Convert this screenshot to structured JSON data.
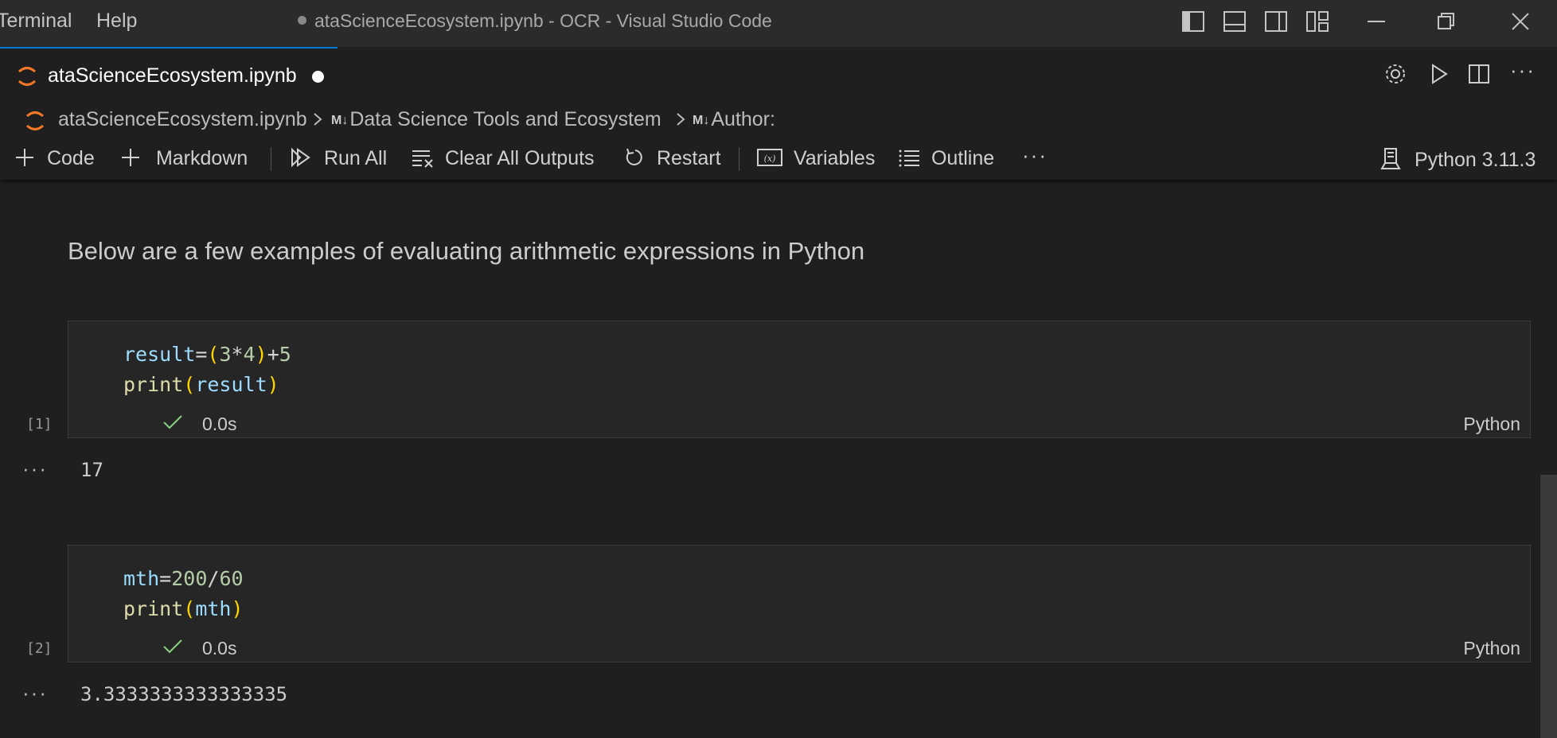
{
  "menu": {
    "items": [
      "Terminal",
      "Help"
    ]
  },
  "window": {
    "title": "ataScienceEcosystem.ipynb - OCR - Visual Studio Code"
  },
  "tab": {
    "label": "ataScienceEcosystem.ipynb"
  },
  "breadcrumb": {
    "file": "ataScienceEcosystem.ipynb",
    "md_badge": "M↓",
    "section1": "Data Science Tools and Ecosystem",
    "section2": "Author:"
  },
  "toolbar": {
    "code": "Code",
    "markdown": "Markdown",
    "run_all": "Run All",
    "clear_all": "Clear All Outputs",
    "restart": "Restart",
    "variables": "Variables",
    "outline": "Outline",
    "more": "···",
    "kernel": "Python 3.11.3"
  },
  "notebook": {
    "markdown_text": "Below are a few examples of evaluating arithmetic expressions in Python",
    "cells": [
      {
        "exec_count": "[1]",
        "time": "0.0s",
        "language": "Python",
        "line1": {
          "var": "result",
          "eq": "=",
          "lp": "(",
          "a": "3",
          "op": "*",
          "b": "4",
          "rp": ")",
          "plus": "+",
          "c": "5"
        },
        "line2": {
          "fn": "print",
          "lp": "(",
          "arg": "result",
          "rp": ")"
        },
        "output": "17"
      },
      {
        "exec_count": "[2]",
        "time": "0.0s",
        "language": "Python",
        "line1": {
          "var": "mth",
          "eq": "=",
          "a": "200",
          "op": "/",
          "b": "60"
        },
        "line2": {
          "fn": "print",
          "lp": "(",
          "arg": "mth",
          "rp": ")"
        },
        "output": "3.3333333333333335"
      }
    ],
    "output_ellipsis": "···"
  },
  "colors": {
    "accent": "#0078d4",
    "check": "#89d185",
    "jupyter": "#f37726"
  }
}
